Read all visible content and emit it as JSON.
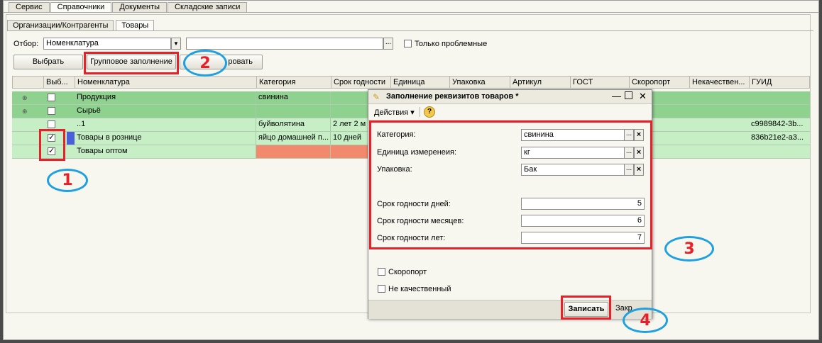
{
  "top_tabs": [
    "Сервис",
    "Справочники",
    "Документы",
    "Складские записи"
  ],
  "active_top_tab": 1,
  "sub_tabs": [
    "Организации/Контрагенты",
    "Товары"
  ],
  "filter": {
    "label": "Отбор:",
    "field_value": "Номенклатура",
    "value_field": "",
    "only_problem_label": "Только проблемные"
  },
  "toolbar": {
    "select_label": "Выбрать",
    "group_fill_label": "Групповое заполнение",
    "third_label": "ровать"
  },
  "table": {
    "columns": [
      "Выб...",
      "Номенклатура",
      "Категория",
      "Срок годности",
      "Единица",
      "Упаковка",
      "Артикул",
      "ГОСТ",
      "Скоропорт",
      "Некачествен...",
      "ГУИД"
    ],
    "rows": [
      {
        "name": "Продукция",
        "category": "свинина",
        "shelf": "",
        "guid": ""
      },
      {
        "name": "Сырьё",
        "category": "",
        "shelf": "",
        "guid": ""
      },
      {
        "name": "..1",
        "category": "буйволятина",
        "shelf": "2 лет 2 м",
        "guid": "c9989842-3b..."
      },
      {
        "name": "Товары в рознице",
        "category": "яйцо домашней п...",
        "shelf": "10 дней",
        "guid": "836b21e2-a3..."
      },
      {
        "name": "Товары оптом",
        "category": "",
        "shelf": "",
        "guid": ""
      }
    ]
  },
  "dialog": {
    "title": "Заполнение реквизитов товаров *",
    "actions_label": "Действия",
    "help_symbol": "?",
    "fields": [
      {
        "label": "Категория:",
        "value": "свинина"
      },
      {
        "label": "Единица измеренеия:",
        "value": "кг"
      },
      {
        "label": "Упаковка:",
        "value": "Бак"
      }
    ],
    "shelf": [
      {
        "label": "Срок годности дней:",
        "value": "5"
      },
      {
        "label": "Срок годности месяцев:",
        "value": "6"
      },
      {
        "label": "Срок годности лет:",
        "value": "7"
      }
    ],
    "checks": [
      "Скоропорт",
      "Не качественный"
    ],
    "save_label": "Записать",
    "close_label": "Закр"
  },
  "callouts": [
    "1",
    "2",
    "3",
    "4"
  ],
  "colors": {
    "green_dark": "#8fd18f",
    "green_light": "#c6efc6",
    "red_cell": "#f2896c",
    "blue_cell": "#4a5fd8",
    "callout_red": "#e8202a",
    "callout_blue": "#1fa0e0"
  }
}
